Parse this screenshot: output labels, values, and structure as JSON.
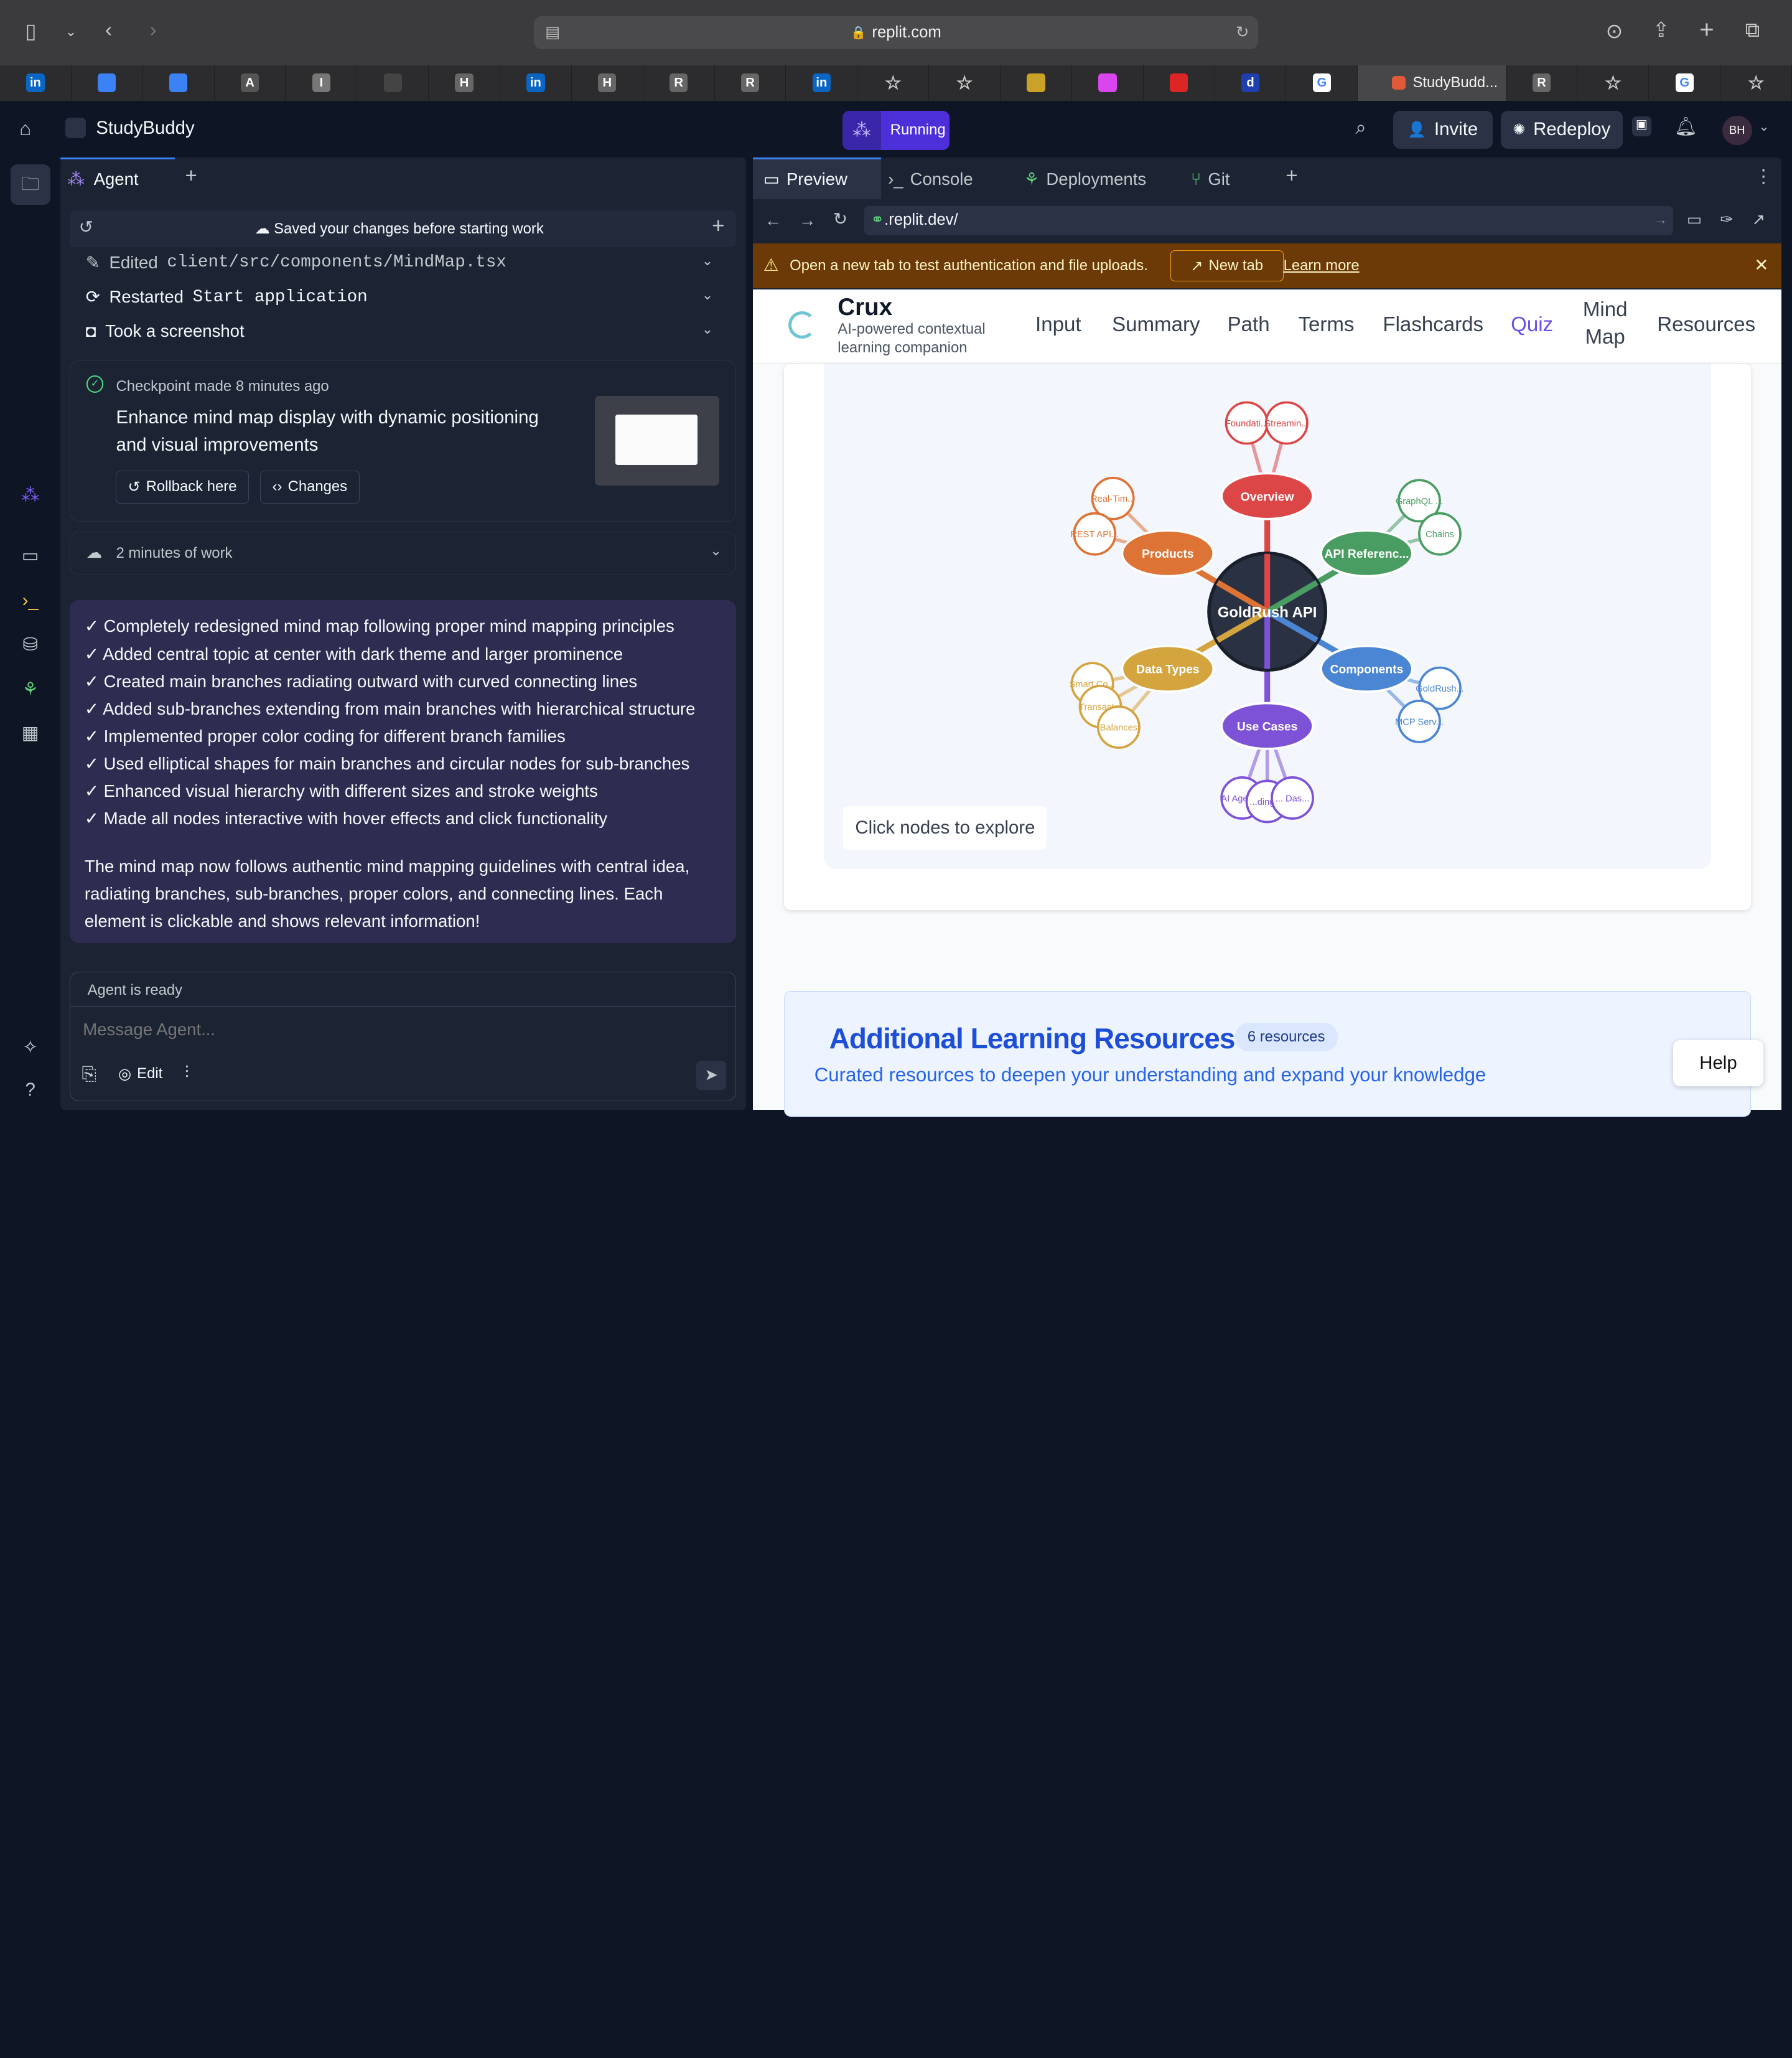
{
  "browser": {
    "url": "replit.com",
    "tabs": [
      {
        "label": "in",
        "icon": "linkedin-icon",
        "color": "#0a66c2"
      },
      {
        "label": "",
        "icon": "bars-icon",
        "color": "#3b82f6"
      },
      {
        "label": "",
        "icon": "bars-icon",
        "color": "#3b82f6"
      },
      {
        "label": "A",
        "icon": "letter-a-icon",
        "color": "#555"
      },
      {
        "label": "I",
        "icon": "letter-i-icon",
        "color": "#777"
      },
      {
        "label": "",
        "icon": "openai-icon",
        "color": "#444"
      },
      {
        "label": "H",
        "icon": "letter-h-icon",
        "color": "#666"
      },
      {
        "label": "in",
        "icon": "linkedin-icon",
        "color": "#0a66c2"
      },
      {
        "label": "H",
        "icon": "letter-h-icon",
        "color": "#666"
      },
      {
        "label": "R",
        "icon": "letter-r-icon",
        "color": "#666"
      },
      {
        "label": "R",
        "icon": "letter-r-icon",
        "color": "#666"
      },
      {
        "label": "in",
        "icon": "linkedin-icon",
        "color": "#0a66c2"
      },
      {
        "label": "☆",
        "icon": "star-icon",
        "color": "transparent"
      },
      {
        "label": "☆",
        "icon": "star-icon",
        "color": "transparent"
      },
      {
        "label": "",
        "icon": "dog-icon",
        "color": "#c9a227"
      },
      {
        "label": "",
        "icon": "puzzle-icon",
        "color": "#d946ef"
      },
      {
        "label": "",
        "icon": "ghost-icon",
        "color": "#dc2626"
      },
      {
        "label": "d",
        "icon": "letter-d-icon",
        "color": "#1e40af"
      },
      {
        "label": "G",
        "icon": "google-icon",
        "color": "#fff"
      }
    ],
    "active_tab": "StudyBudd...",
    "tabs_after": [
      {
        "label": "R",
        "icon": "letter-r-icon",
        "color": "#666"
      },
      {
        "label": "☆",
        "icon": "star-icon",
        "color": "transparent"
      },
      {
        "label": "G",
        "icon": "google-icon",
        "color": "#fff"
      },
      {
        "label": "☆",
        "icon": "star-icon",
        "color": "transparent"
      }
    ]
  },
  "header": {
    "project": "StudyBuddy",
    "run_status": "Running",
    "invite": "Invite",
    "redeploy": "Redeploy",
    "avatar": "BH"
  },
  "agent": {
    "tab": "Agent",
    "saved_note": "Saved your changes before starting work",
    "steps": [
      {
        "verb": "Edited",
        "target": "client/src/components/MindMap.tsx"
      },
      {
        "verb": "Restarted",
        "target": "Start application"
      },
      {
        "verb": "Took a screenshot",
        "target": ""
      }
    ],
    "checkpoint": {
      "label": "Checkpoint made",
      "time": "8 minutes ago",
      "title": "Enhance mind map display with dynamic positioning and visual improvements",
      "rollback": "Rollback here",
      "changes": "Changes"
    },
    "work": "2 minutes of work",
    "bullets": [
      "✓ Completely redesigned mind map following proper mind mapping principles",
      "✓ Added central topic at center with dark theme and larger prominence",
      "✓ Created main branches radiating outward with curved connecting lines",
      "✓ Added sub-branches extending from main branches with hierarchical structure",
      "✓ Implemented proper color coding for different branch families",
      "✓ Used elliptical shapes for main branches and circular nodes for sub-branches",
      "✓ Enhanced visual hierarchy with different sizes and stroke weights",
      "✓ Made all nodes interactive with hover effects and click functionality"
    ],
    "closing": "The mind map now follows authentic mind mapping guidelines with central idea, radiating branches, sub-branches, proper colors, and connecting lines. Each element is clickable and shows relevant information!",
    "status": "Agent is ready",
    "placeholder": "Message Agent...",
    "edit": "Edit"
  },
  "preview": {
    "tabs": [
      "Preview",
      "Console",
      "Deployments",
      "Git"
    ],
    "url": ".replit.dev/",
    "banner": "Open a new tab to test authentication and file uploads.",
    "new_tab": "New tab",
    "learn_more": "Learn more"
  },
  "site": {
    "brand": "Crux",
    "tagline_1": "AI-powered contextual",
    "tagline_2": "learning companion",
    "nav": [
      "Input",
      "Summary",
      "Path",
      "Terms",
      "Flashcards",
      "Quiz",
      "Mind",
      "Map",
      "Resources"
    ],
    "active_nav": "Quiz",
    "hint": "Click nodes to explore",
    "resources_title": "Additional Learning Resources",
    "resources_count": "6 resources",
    "resources_sub": "Curated resources to deepen your understanding and expand your knowledge",
    "help": "Help"
  },
  "mindmap": {
    "center": "GoldRush API",
    "branches": [
      {
        "label": "Overview",
        "color": "#dc4646",
        "subs": [
          "Foundati...",
          "Streamin..."
        ]
      },
      {
        "label": "API Referenc...",
        "color": "#4a9d62",
        "subs": [
          "GraphQL ...",
          "Chains"
        ]
      },
      {
        "label": "Components",
        "color": "#4a86d4",
        "subs": [
          "GoldRush...",
          "MCP Serv..."
        ]
      },
      {
        "label": "Use Cases",
        "color": "#7d52d6",
        "subs": [
          "AI Agent...",
          "...ding ...",
          "... Das..."
        ]
      },
      {
        "label": "Data Types",
        "color": "#d4a43f",
        "subs": [
          "Smart Co...",
          "Transact...",
          "Balances"
        ]
      },
      {
        "label": "Products",
        "color": "#dd7335",
        "subs": [
          "Real-Tim...",
          "REST API..."
        ]
      }
    ]
  }
}
